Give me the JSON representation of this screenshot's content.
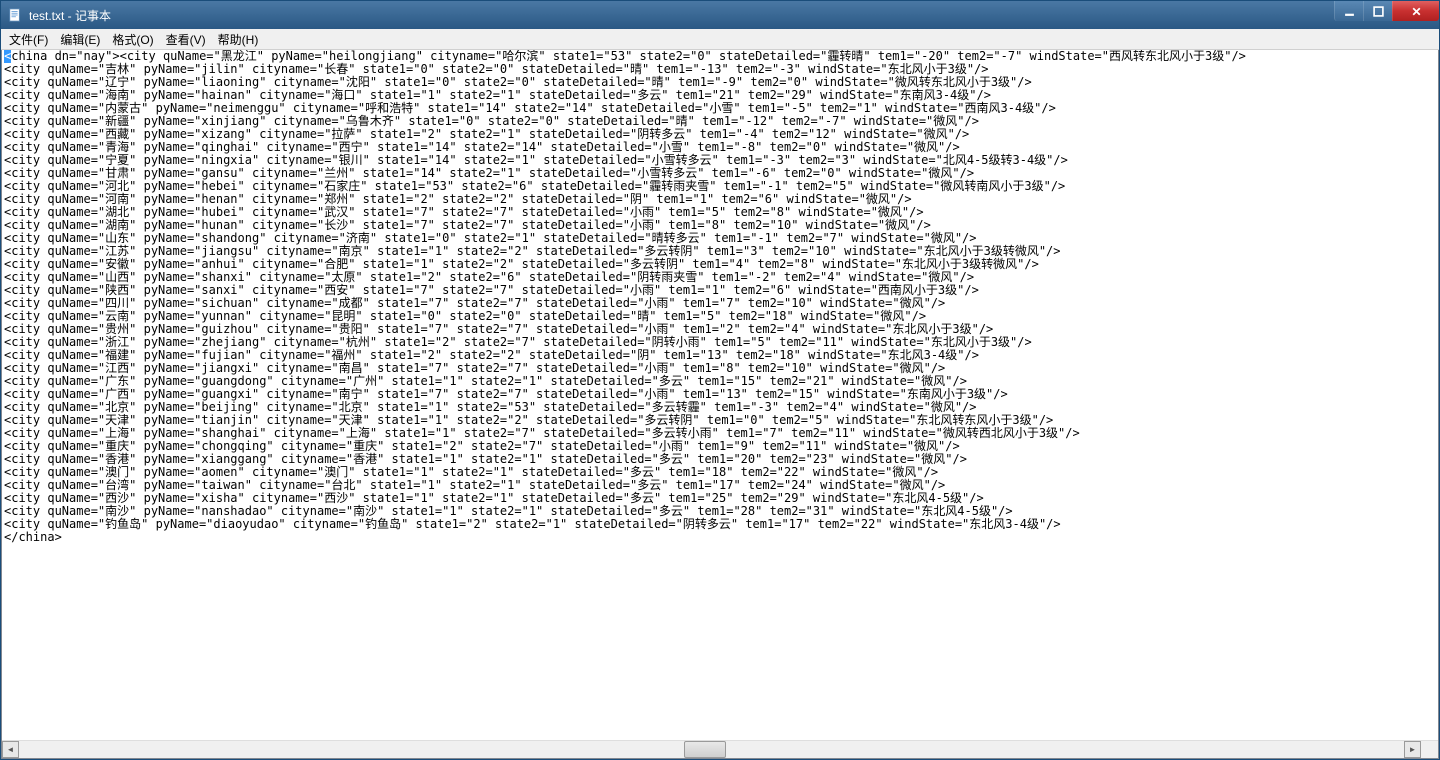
{
  "window": {
    "title": "test.txt - 记事本",
    "icon": "notepad-icon"
  },
  "menu": {
    "file": "文件(F)",
    "edit": "编辑(E)",
    "format": "格式(O)",
    "view": "查看(V)",
    "help": "帮助(H)"
  },
  "wbtn": {
    "min": "minimize",
    "max": "maximize",
    "close": "close"
  },
  "doc": {
    "root_open_sel": "<",
    "root_open_rest": "china dn=\"nay\">",
    "root_close": "</china>",
    "cities": [
      {
        "quName": "黑龙江",
        "pyName": "heilongjiang",
        "cityname": "哈尔滨",
        "state1": "53",
        "state2": "0",
        "stateDetailed": "霾转晴",
        "tem1": "-20",
        "tem2": "-7",
        "windState": "西风转东北风小于3级"
      },
      {
        "quName": "吉林",
        "pyName": "jilin",
        "cityname": "长春",
        "state1": "0",
        "state2": "0",
        "stateDetailed": "晴",
        "tem1": "-13",
        "tem2": "-3",
        "windState": "东北风小于3级"
      },
      {
        "quName": "辽宁",
        "pyName": "liaoning",
        "cityname": "沈阳",
        "state1": "0",
        "state2": "0",
        "stateDetailed": "晴",
        "tem1": "-9",
        "tem2": "0",
        "windState": "微风转东北风小于3级"
      },
      {
        "quName": "海南",
        "pyName": "hainan",
        "cityname": "海口",
        "state1": "1",
        "state2": "1",
        "stateDetailed": "多云",
        "tem1": "21",
        "tem2": "29",
        "windState": "东南风3-4级"
      },
      {
        "quName": "内蒙古",
        "pyName": "neimenggu",
        "cityname": "呼和浩特",
        "state1": "14",
        "state2": "14",
        "stateDetailed": "小雪",
        "tem1": "-5",
        "tem2": "1",
        "windState": "西南风3-4级"
      },
      {
        "quName": "新疆",
        "pyName": "xinjiang",
        "cityname": "乌鲁木齐",
        "state1": "0",
        "state2": "0",
        "stateDetailed": "晴",
        "tem1": "-12",
        "tem2": "-7",
        "windState": "微风"
      },
      {
        "quName": "西藏",
        "pyName": "xizang",
        "cityname": "拉萨",
        "state1": "2",
        "state2": "1",
        "stateDetailed": "阴转多云",
        "tem1": "-4",
        "tem2": "12",
        "windState": "微风"
      },
      {
        "quName": "青海",
        "pyName": "qinghai",
        "cityname": "西宁",
        "state1": "14",
        "state2": "14",
        "stateDetailed": "小雪",
        "tem1": "-8",
        "tem2": "0",
        "windState": "微风"
      },
      {
        "quName": "宁夏",
        "pyName": "ningxia",
        "cityname": "银川",
        "state1": "14",
        "state2": "1",
        "stateDetailed": "小雪转多云",
        "tem1": "-3",
        "tem2": "3",
        "windState": "北风4-5级转3-4级"
      },
      {
        "quName": "甘肃",
        "pyName": "gansu",
        "cityname": "兰州",
        "state1": "14",
        "state2": "1",
        "stateDetailed": "小雪转多云",
        "tem1": "-6",
        "tem2": "0",
        "windState": "微风"
      },
      {
        "quName": "河北",
        "pyName": "hebei",
        "cityname": "石家庄",
        "state1": "53",
        "state2": "6",
        "stateDetailed": "霾转雨夹雪",
        "tem1": "-1",
        "tem2": "5",
        "windState": "微风转南风小于3级"
      },
      {
        "quName": "河南",
        "pyName": "henan",
        "cityname": "郑州",
        "state1": "2",
        "state2": "2",
        "stateDetailed": "阴",
        "tem1": "1",
        "tem2": "6",
        "windState": "微风"
      },
      {
        "quName": "湖北",
        "pyName": "hubei",
        "cityname": "武汉",
        "state1": "7",
        "state2": "7",
        "stateDetailed": "小雨",
        "tem1": "5",
        "tem2": "8",
        "windState": "微风"
      },
      {
        "quName": "湖南",
        "pyName": "hunan",
        "cityname": "长沙",
        "state1": "7",
        "state2": "7",
        "stateDetailed": "小雨",
        "tem1": "8",
        "tem2": "10",
        "windState": "微风"
      },
      {
        "quName": "山东",
        "pyName": "shandong",
        "cityname": "济南",
        "state1": "0",
        "state2": "1",
        "stateDetailed": "晴转多云",
        "tem1": "-1",
        "tem2": "7",
        "windState": "微风"
      },
      {
        "quName": "江苏",
        "pyName": "jiangsu",
        "cityname": "南京",
        "state1": "1",
        "state2": "2",
        "stateDetailed": "多云转阴",
        "tem1": "3",
        "tem2": "10",
        "windState": "东北风小于3级转微风"
      },
      {
        "quName": "安徽",
        "pyName": "anhui",
        "cityname": "合肥",
        "state1": "1",
        "state2": "2",
        "stateDetailed": "多云转阴",
        "tem1": "4",
        "tem2": "8",
        "windState": "东北风小于3级转微风"
      },
      {
        "quName": "山西",
        "pyName": "shanxi",
        "cityname": "太原",
        "state1": "2",
        "state2": "6",
        "stateDetailed": "阴转雨夹雪",
        "tem1": "-2",
        "tem2": "4",
        "windState": "微风"
      },
      {
        "quName": "陕西",
        "pyName": "sanxi",
        "cityname": "西安",
        "state1": "7",
        "state2": "7",
        "stateDetailed": "小雨",
        "tem1": "1",
        "tem2": "6",
        "windState": "西南风小于3级"
      },
      {
        "quName": "四川",
        "pyName": "sichuan",
        "cityname": "成都",
        "state1": "7",
        "state2": "7",
        "stateDetailed": "小雨",
        "tem1": "7",
        "tem2": "10",
        "windState": "微风"
      },
      {
        "quName": "云南",
        "pyName": "yunnan",
        "cityname": "昆明",
        "state1": "0",
        "state2": "0",
        "stateDetailed": "晴",
        "tem1": "5",
        "tem2": "18",
        "windState": "微风"
      },
      {
        "quName": "贵州",
        "pyName": "guizhou",
        "cityname": "贵阳",
        "state1": "7",
        "state2": "7",
        "stateDetailed": "小雨",
        "tem1": "2",
        "tem2": "4",
        "windState": "东北风小于3级"
      },
      {
        "quName": "浙江",
        "pyName": "zhejiang",
        "cityname": "杭州",
        "state1": "2",
        "state2": "7",
        "stateDetailed": "阴转小雨",
        "tem1": "5",
        "tem2": "11",
        "windState": "东北风小于3级"
      },
      {
        "quName": "福建",
        "pyName": "fujian",
        "cityname": "福州",
        "state1": "2",
        "state2": "2",
        "stateDetailed": "阴",
        "tem1": "13",
        "tem2": "18",
        "windState": "东北风3-4级"
      },
      {
        "quName": "江西",
        "pyName": "jiangxi",
        "cityname": "南昌",
        "state1": "7",
        "state2": "7",
        "stateDetailed": "小雨",
        "tem1": "8",
        "tem2": "10",
        "windState": "微风"
      },
      {
        "quName": "广东",
        "pyName": "guangdong",
        "cityname": "广州",
        "state1": "1",
        "state2": "1",
        "stateDetailed": "多云",
        "tem1": "15",
        "tem2": "21",
        "windState": "微风"
      },
      {
        "quName": "广西",
        "pyName": "guangxi",
        "cityname": "南宁",
        "state1": "7",
        "state2": "7",
        "stateDetailed": "小雨",
        "tem1": "13",
        "tem2": "15",
        "windState": "东南风小于3级"
      },
      {
        "quName": "北京",
        "pyName": "beijing",
        "cityname": "北京",
        "state1": "1",
        "state2": "53",
        "stateDetailed": "多云转霾",
        "tem1": "-3",
        "tem2": "4",
        "windState": "微风"
      },
      {
        "quName": "天津",
        "pyName": "tianjin",
        "cityname": "天津",
        "state1": "1",
        "state2": "2",
        "stateDetailed": "多云转阴",
        "tem1": "0",
        "tem2": "5",
        "windState": "东北风转东风小于3级"
      },
      {
        "quName": "上海",
        "pyName": "shanghai",
        "cityname": "上海",
        "state1": "1",
        "state2": "7",
        "stateDetailed": "多云转小雨",
        "tem1": "7",
        "tem2": "11",
        "windState": "微风转西北风小于3级"
      },
      {
        "quName": "重庆",
        "pyName": "chongqing",
        "cityname": "重庆",
        "state1": "2",
        "state2": "7",
        "stateDetailed": "小雨",
        "tem1": "9",
        "tem2": "11",
        "windState": "微风"
      },
      {
        "quName": "香港",
        "pyName": "xianggang",
        "cityname": "香港",
        "state1": "1",
        "state2": "1",
        "stateDetailed": "多云",
        "tem1": "20",
        "tem2": "23",
        "windState": "微风"
      },
      {
        "quName": "澳门",
        "pyName": "aomen",
        "cityname": "澳门",
        "state1": "1",
        "state2": "1",
        "stateDetailed": "多云",
        "tem1": "18",
        "tem2": "22",
        "windState": "微风"
      },
      {
        "quName": "台湾",
        "pyName": "taiwan",
        "cityname": "台北",
        "state1": "1",
        "state2": "1",
        "stateDetailed": "多云",
        "tem1": "17",
        "tem2": "24",
        "windState": "微风"
      },
      {
        "quName": "西沙",
        "pyName": "xisha",
        "cityname": "西沙",
        "state1": "1",
        "state2": "1",
        "stateDetailed": "多云",
        "tem1": "25",
        "tem2": "29",
        "windState": "东北风4-5级"
      },
      {
        "quName": "南沙",
        "pyName": "nanshadao",
        "cityname": "南沙",
        "state1": "1",
        "state2": "1",
        "stateDetailed": "多云",
        "tem1": "28",
        "tem2": "31",
        "windState": "东北风4-5级"
      },
      {
        "quName": "钓鱼岛",
        "pyName": "diaoyudao",
        "cityname": "钓鱼岛",
        "state1": "2",
        "state2": "1",
        "stateDetailed": "阴转多云",
        "tem1": "17",
        "tem2": "22",
        "windState": "东北风3-4级"
      }
    ]
  }
}
